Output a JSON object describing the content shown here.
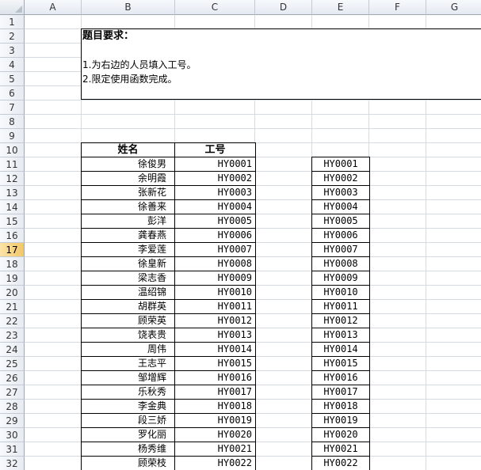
{
  "columns": [
    "A",
    "B",
    "C",
    "D",
    "E",
    "F",
    "G"
  ],
  "rows": [
    "1",
    "2",
    "3",
    "4",
    "5",
    "6",
    "7",
    "8",
    "9",
    "10",
    "11",
    "12",
    "13",
    "14",
    "15",
    "16",
    "17",
    "18",
    "19",
    "20",
    "21",
    "22",
    "23",
    "24",
    "25",
    "26",
    "27",
    "28",
    "29",
    "30",
    "31",
    "32"
  ],
  "active_row": "17",
  "task": {
    "title": "题目要求：",
    "line1": "1.为右边的人员填入工号。",
    "line2": "2.限定使用函数完成。"
  },
  "table": {
    "header_name": "姓名",
    "header_code": "工号",
    "rows": [
      {
        "name": "徐俊男",
        "code": "HY0001"
      },
      {
        "name": "余明霞",
        "code": "HY0002"
      },
      {
        "name": "张新花",
        "code": "HY0003"
      },
      {
        "name": "徐善来",
        "code": "HY0004"
      },
      {
        "name": "彭洋",
        "code": "HY0005"
      },
      {
        "name": "龚春燕",
        "code": "HY0006"
      },
      {
        "name": "李爱莲",
        "code": "HY0007"
      },
      {
        "name": "徐皇新",
        "code": "HY0008"
      },
      {
        "name": "梁志香",
        "code": "HY0009"
      },
      {
        "name": "温绍锦",
        "code": "HY0010"
      },
      {
        "name": "胡群英",
        "code": "HY0011"
      },
      {
        "name": "顾荣英",
        "code": "HY0012"
      },
      {
        "name": "饶表贵",
        "code": "HY0013"
      },
      {
        "name": "周伟",
        "code": "HY0014"
      },
      {
        "name": "王志平",
        "code": "HY0015"
      },
      {
        "name": "邹增辉",
        "code": "HY0016"
      },
      {
        "name": "乐秋秀",
        "code": "HY0017"
      },
      {
        "name": "李金典",
        "code": "HY0018"
      },
      {
        "name": "段三娇",
        "code": "HY0019"
      },
      {
        "name": "罗化丽",
        "code": "HY0020"
      },
      {
        "name": "杨秀维",
        "code": "HY0021"
      },
      {
        "name": "顾荣枝",
        "code": "HY0022"
      }
    ]
  },
  "right_codes": [
    "HY0001",
    "HY0002",
    "HY0003",
    "HY0004",
    "HY0005",
    "HY0006",
    "HY0007",
    "HY0008",
    "HY0009",
    "HY0010",
    "HY0011",
    "HY0012",
    "HY0013",
    "HY0014",
    "HY0015",
    "HY0016",
    "HY0017",
    "HY0018",
    "HY0019",
    "HY0020",
    "HY0021",
    "HY0022"
  ]
}
